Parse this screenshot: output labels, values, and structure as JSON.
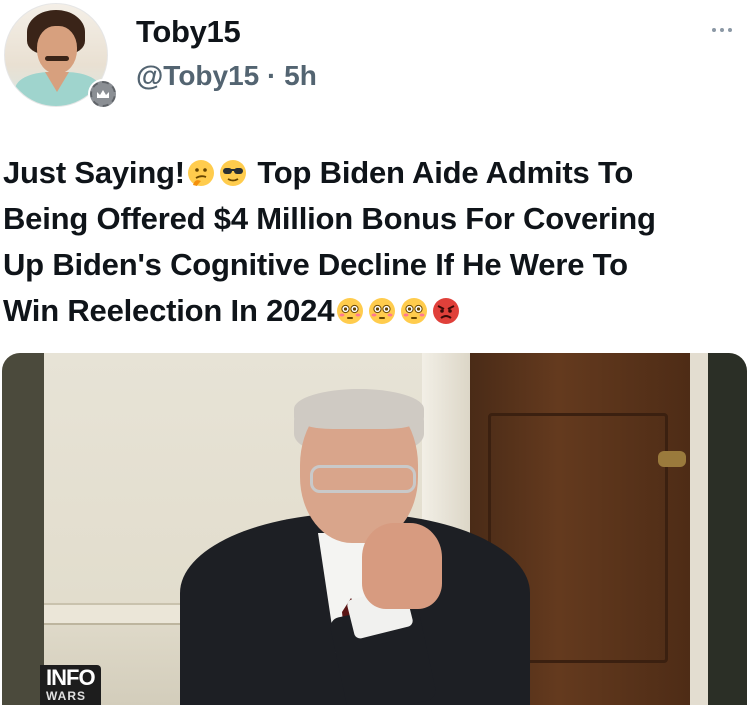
{
  "post": {
    "author": {
      "display_name": "Toby15",
      "handle": "@Toby15",
      "separator": "·",
      "time": "5h",
      "avatar_icon": "profile-photo",
      "badge_icon": "gear-crown-badge-icon"
    },
    "more_icon": "ellipsis-icon",
    "text_lines": [
      {
        "before": "Just Saying!",
        "emojis": [
          "thinking-face-emoji",
          "sunglasses-face-emoji"
        ],
        "after": " Top Biden Aide Admits To"
      },
      {
        "text": "Being Offered $4 Million Bonus For Covering"
      },
      {
        "text": "Up Biden's Cognitive Decline If He Were To"
      },
      {
        "text": "Win Reelection In 2024",
        "emojis_after": [
          "flushed-face-emoji",
          "flushed-face-emoji",
          "flushed-face-emoji",
          "angry-face-emoji"
        ]
      }
    ],
    "media": {
      "watermark": "INFO",
      "watermark_sub": "WARS"
    }
  }
}
